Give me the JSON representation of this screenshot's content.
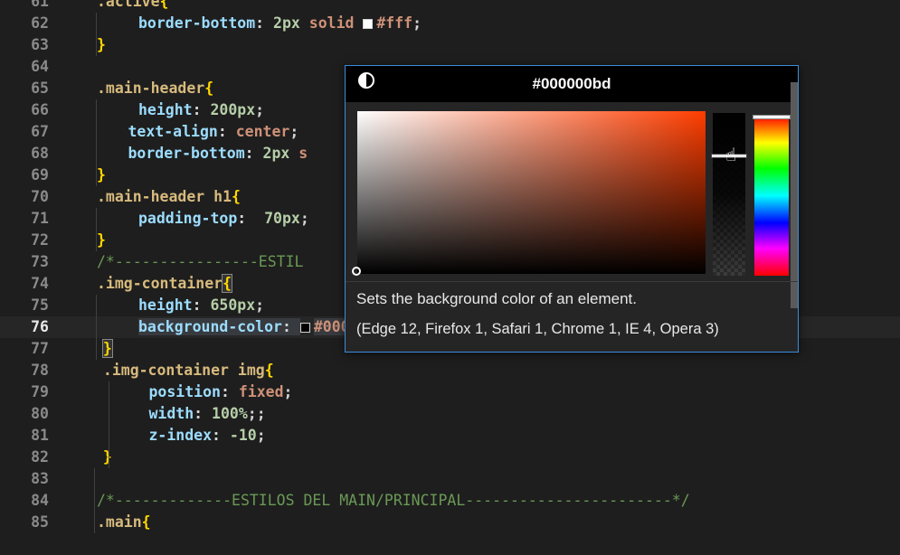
{
  "editor": {
    "lines": [
      {
        "n": "61",
        "indent": 0,
        "tokens": [
          {
            "t": ".active",
            "c": "sel"
          },
          {
            "t": "{",
            "c": "br"
          }
        ]
      },
      {
        "n": "62",
        "indent": 1,
        "tokens": [
          {
            "t": "border-bottom",
            "c": "prop"
          },
          {
            "t": ": ",
            "c": "pun"
          },
          {
            "t": "2px",
            "c": "num"
          },
          {
            "t": " solid ",
            "c": "val"
          },
          {
            "t": "#fff",
            "c": "val",
            "swatch": "#ffffff"
          },
          {
            "t": ";",
            "c": "pun"
          }
        ]
      },
      {
        "n": "63",
        "indent": 0,
        "tokens": [
          {
            "t": "}",
            "c": "br"
          }
        ]
      },
      {
        "n": "64",
        "indent": 0,
        "tokens": []
      },
      {
        "n": "65",
        "indent": 0,
        "tokens": [
          {
            "t": ".main-header",
            "c": "sel"
          },
          {
            "t": "{",
            "c": "br"
          }
        ]
      },
      {
        "n": "66",
        "indent": 1,
        "tokens": [
          {
            "t": "height",
            "c": "prop"
          },
          {
            "t": ": ",
            "c": "pun"
          },
          {
            "t": "200px",
            "c": "num"
          },
          {
            "t": ";",
            "c": "pun"
          }
        ]
      },
      {
        "n": "67",
        "indent": 0.75,
        "tokens": [
          {
            "t": "text-align",
            "c": "prop"
          },
          {
            "t": ": ",
            "c": "pun"
          },
          {
            "t": "center",
            "c": "val"
          },
          {
            "t": ";",
            "c": "pun"
          }
        ]
      },
      {
        "n": "68",
        "indent": 0.75,
        "tokens": [
          {
            "t": "border-bottom",
            "c": "prop"
          },
          {
            "t": ": ",
            "c": "pun"
          },
          {
            "t": "2px",
            "c": "num"
          },
          {
            "t": " s",
            "c": "val"
          }
        ]
      },
      {
        "n": "69",
        "indent": 0,
        "tokens": [
          {
            "t": "}",
            "c": "br"
          }
        ]
      },
      {
        "n": "70",
        "indent": 0,
        "tokens": [
          {
            "t": ".main-header h1",
            "c": "sel"
          },
          {
            "t": "{",
            "c": "br"
          }
        ]
      },
      {
        "n": "71",
        "indent": 1,
        "tokens": [
          {
            "t": "padding-top",
            "c": "prop"
          },
          {
            "t": ":  ",
            "c": "pun"
          },
          {
            "t": "70px",
            "c": "num"
          },
          {
            "t": ";",
            "c": "pun"
          }
        ]
      },
      {
        "n": "72",
        "indent": 0,
        "tokens": [
          {
            "t": "}",
            "c": "br"
          }
        ]
      },
      {
        "n": "73",
        "indent": 0,
        "tokens": [
          {
            "t": "/*----------------ESTIL",
            "c": "cmt"
          }
        ]
      },
      {
        "n": "74",
        "indent": 0,
        "tokens": [
          {
            "t": ".img-container",
            "c": "sel"
          },
          {
            "t": "{",
            "c": "br",
            "match": true
          }
        ]
      },
      {
        "n": "75",
        "indent": 1,
        "tokens": [
          {
            "t": "height",
            "c": "prop"
          },
          {
            "t": ": ",
            "c": "pun"
          },
          {
            "t": "650px",
            "c": "num"
          },
          {
            "t": ";",
            "c": "pun"
          }
        ]
      },
      {
        "n": "76",
        "indent": 1,
        "current": true,
        "tokens": [
          {
            "t": "background-color",
            "c": "prop",
            "hl": true
          },
          {
            "t": ": ",
            "c": "pun",
            "hl": true
          },
          {
            "t": "#000000bd",
            "c": "val",
            "swatch": "#000000",
            "hl": true
          },
          {
            "t": ";",
            "c": "pun"
          }
        ]
      },
      {
        "n": "77",
        "indent": 0.15,
        "tokens": [
          {
            "t": "}",
            "c": "br",
            "match": true
          }
        ]
      },
      {
        "n": "78",
        "indent": 0.15,
        "tokens": [
          {
            "t": ".img-container img",
            "c": "sel"
          },
          {
            "t": "{",
            "c": "br"
          }
        ]
      },
      {
        "n": "79",
        "indent": 1.25,
        "tokens": [
          {
            "t": "position",
            "c": "prop"
          },
          {
            "t": ": ",
            "c": "pun"
          },
          {
            "t": "fixed",
            "c": "val"
          },
          {
            "t": ";",
            "c": "pun"
          }
        ]
      },
      {
        "n": "80",
        "indent": 1.25,
        "tokens": [
          {
            "t": "width",
            "c": "prop"
          },
          {
            "t": ": ",
            "c": "pun"
          },
          {
            "t": "100%",
            "c": "num"
          },
          {
            "t": ";;",
            "c": "pun"
          }
        ]
      },
      {
        "n": "81",
        "indent": 1.25,
        "tokens": [
          {
            "t": "z-index",
            "c": "prop"
          },
          {
            "t": ": ",
            "c": "pun"
          },
          {
            "t": "-10",
            "c": "num"
          },
          {
            "t": ";",
            "c": "pun"
          }
        ]
      },
      {
        "n": "82",
        "indent": 0.15,
        "tokens": [
          {
            "t": "}",
            "c": "br"
          }
        ]
      },
      {
        "n": "83",
        "indent": 0,
        "tokens": []
      },
      {
        "n": "84",
        "indent": 0,
        "tokens": [
          {
            "t": "/*-------------ESTILOS DEL MAIN/PRINCIPAL-----------------------*/",
            "c": "cmt"
          }
        ]
      },
      {
        "n": "85",
        "indent": 0,
        "tokens": [
          {
            "t": ".main",
            "c": "sel"
          },
          {
            "t": "{",
            "c": "br"
          }
        ]
      }
    ]
  },
  "color_picker": {
    "hex_value": "#000000bd",
    "contrast_icon": "contrast-icon",
    "hue_color": "#ff3d00",
    "hover_description": "Sets the background color of an element.",
    "hover_compat": "(Edge 12, Firefox 1, Safari 1, Chrome 1, IE 4, Opera 3)"
  }
}
